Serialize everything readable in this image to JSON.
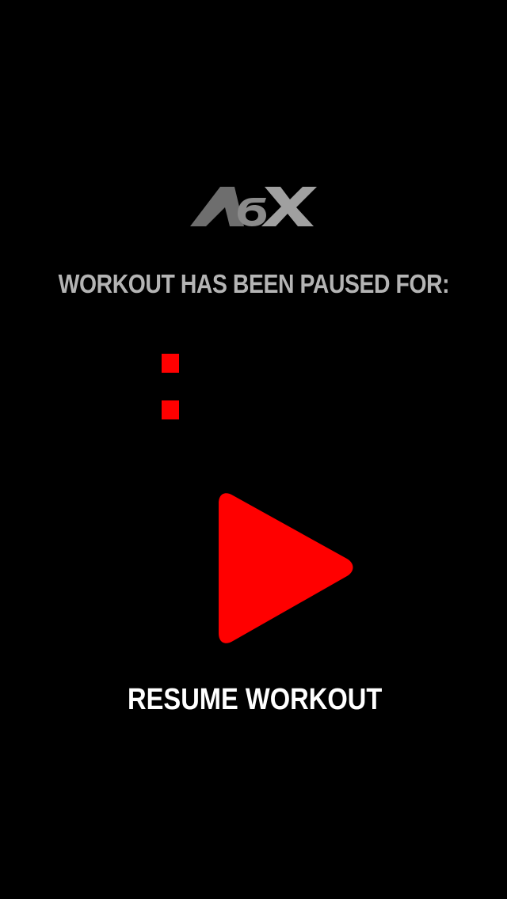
{
  "logo": {
    "text": "A6X",
    "icon": "a6x-logo"
  },
  "pause_screen": {
    "message": "WORKOUT HAS BEEN PAUSED FOR:",
    "timer_indicator_color": "#ff0000"
  },
  "resume": {
    "icon": "play-icon",
    "label": "RESUME WORKOUT",
    "accent_color": "#ff0000"
  }
}
